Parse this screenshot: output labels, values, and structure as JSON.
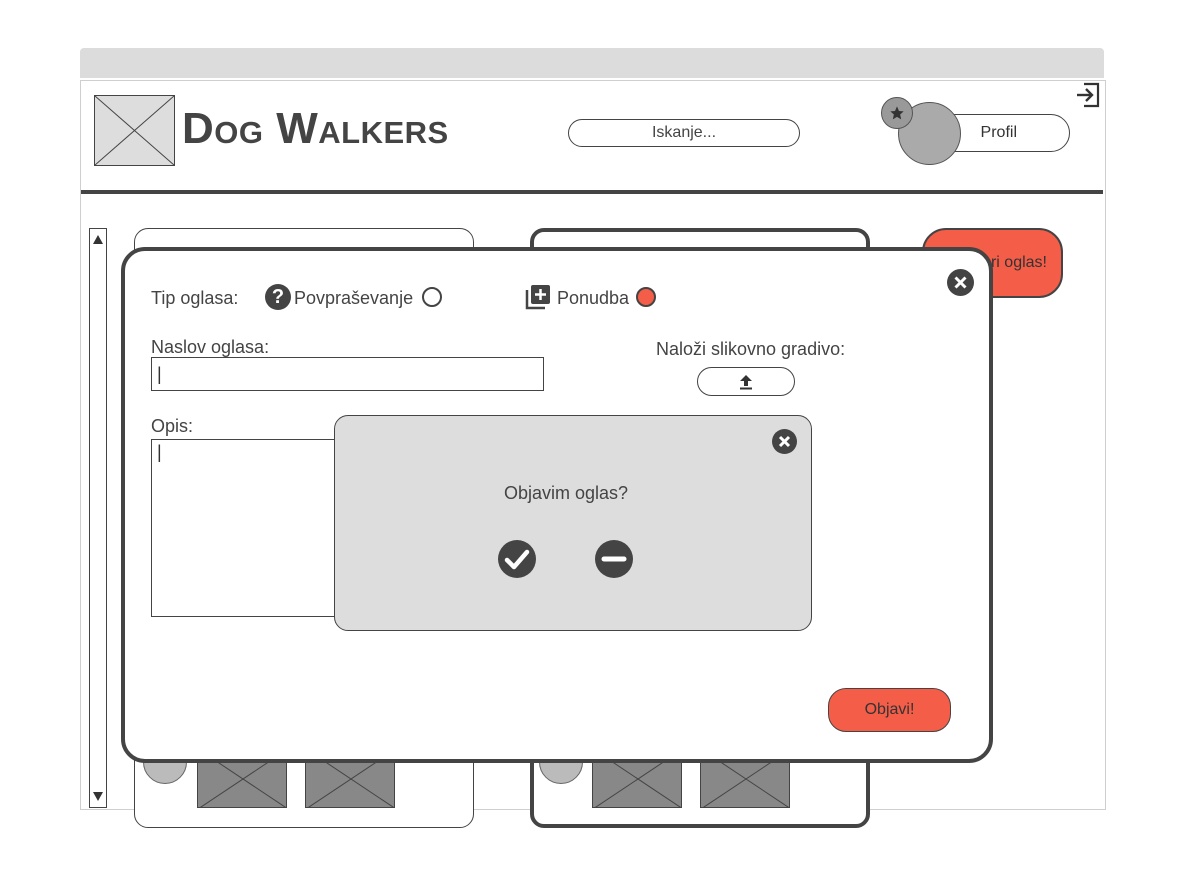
{
  "header": {
    "site_title": "Dog Walkers",
    "search_placeholder": "Iskanje...",
    "profile_label": "Profil"
  },
  "background": {
    "create_ad_label": "ri oglas!"
  },
  "ad_form": {
    "ad_type_label": "Tip oglasa:",
    "type_request_label": "Povpraševanje",
    "type_offer_label": "Ponudba",
    "selected_type": "Ponudba",
    "title_label": "Naslov oglasa:",
    "title_value": "|",
    "upload_label": "Naloži slikovno gradivo:",
    "description_label": "Opis:",
    "description_value": "|",
    "publish_label": "Objavi!"
  },
  "confirm_dialog": {
    "question": "Objavim oglas?"
  },
  "colors": {
    "accent": "#f45d48",
    "dark": "#444444",
    "dialog_bg": "#dddddd"
  },
  "icons": {
    "help": "help-icon",
    "add": "add-box-icon",
    "close": "close-icon",
    "upload": "upload-icon",
    "confirm": "check-icon",
    "cancel": "minus-icon",
    "logout": "logout-icon",
    "star": "star-icon"
  }
}
